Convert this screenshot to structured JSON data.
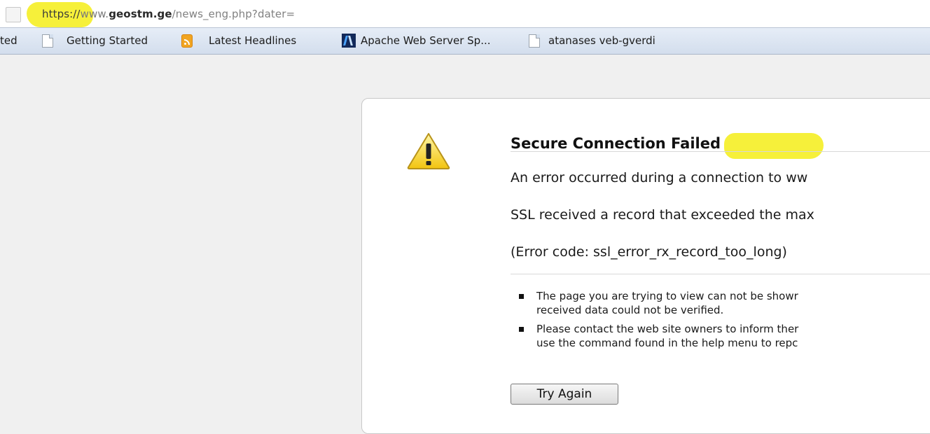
{
  "address_bar": {
    "scheme": "https://",
    "host_prefix": "www.",
    "domain": "geostm.ge",
    "path": "/news_eng.php?dater="
  },
  "bookmarks": [
    {
      "label": "ted",
      "icon": "none"
    },
    {
      "label": "Getting Started",
      "icon": "page-icon"
    },
    {
      "label": "Latest Headlines",
      "icon": "rss-feed-icon"
    },
    {
      "label": "Apache Web Server Sp...",
      "icon": "apache-icon"
    },
    {
      "label": "atanases veb-gverdi",
      "icon": "page-icon"
    }
  ],
  "error": {
    "icon": "warning-icon",
    "title": "Secure Connection Failed",
    "description": "An error occurred during a connection to ww",
    "ssl_message": "SSL received a record that exceeded the max",
    "error_code": "(Error code: ssl_error_rx_record_too_long)",
    "bullets": [
      {
        "line1": "The page you are trying to view can not be showr",
        "line2": "received data could not be verified."
      },
      {
        "line1": "Please contact the web site owners to inform ther",
        "line2": "use the command found in the help menu to repc"
      }
    ],
    "try_again_label": "Try Again"
  },
  "highlight_color": "#f6f03a"
}
